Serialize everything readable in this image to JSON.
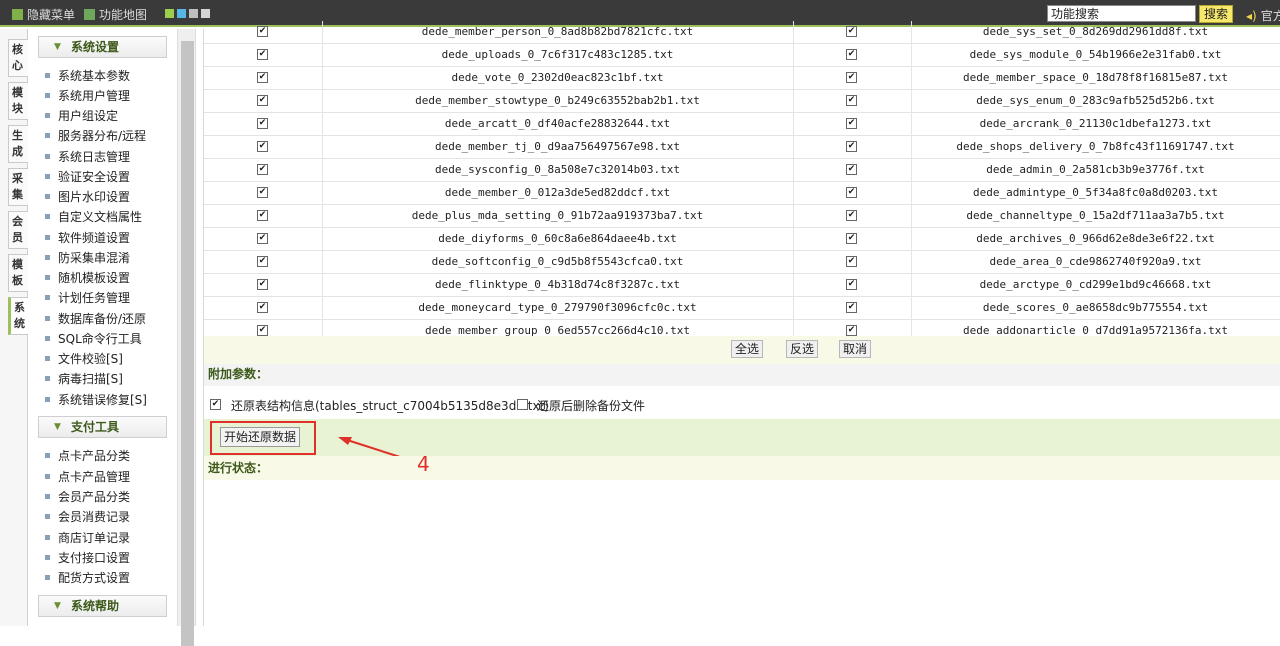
{
  "topbar": {
    "hide_menu": "隐藏菜单",
    "site_map": "功能地图",
    "search_value": "功能搜索",
    "search_button": "搜索",
    "official": "官方"
  },
  "left_tabs": [
    {
      "label": "核\n心"
    },
    {
      "label": "模\n块"
    },
    {
      "label": "生\n成"
    },
    {
      "label": "采\n集"
    },
    {
      "label": "会\n员"
    },
    {
      "label": "模\n板"
    },
    {
      "label": "系\n统"
    }
  ],
  "sidebar": {
    "sections": [
      {
        "title": "系统设置",
        "items": [
          "系统基本参数",
          "系统用户管理",
          "用户组设定",
          "服务器分布/远程",
          "系统日志管理",
          "验证安全设置",
          "图片水印设置",
          "自定义文档属性",
          "软件频道设置",
          "防采集串混淆",
          "随机模板设置",
          "计划任务管理",
          "数据库备份/还原",
          "SQL命令行工具",
          "文件校验[S]",
          "病毒扫描[S]",
          "系统错误修复[S]"
        ]
      },
      {
        "title": "支付工具",
        "items": [
          "点卡产品分类",
          "点卡产品管理",
          "会员产品分类",
          "会员消费记录",
          "商店订单记录",
          "支付接口设置",
          "配货方式设置"
        ]
      },
      {
        "title": "系统帮助",
        "items": []
      }
    ]
  },
  "table": {
    "rows": [
      {
        "left": "dede_member_person_0_8ad8b82bd7821cfc.txt",
        "right": "dede_sys_set_0_8d269dd2961dd8f.txt"
      },
      {
        "left": "dede_uploads_0_7c6f317c483c1285.txt",
        "right": "dede_sys_module_0_54b1966e2e31fab0.txt"
      },
      {
        "left": "dede_vote_0_2302d0eac823c1bf.txt",
        "right": "dede_member_space_0_18d78f8f16815e87.txt"
      },
      {
        "left": "dede_member_stowtype_0_b249c63552bab2b1.txt",
        "right": "dede_sys_enum_0_283c9afb525d52b6.txt"
      },
      {
        "left": "dede_arcatt_0_df40acfe28832644.txt",
        "right": "dede_arcrank_0_21130c1dbefa1273.txt"
      },
      {
        "left": "dede_member_tj_0_d9aa756497567e98.txt",
        "right": "dede_shops_delivery_0_7b8fc43f11691747.txt"
      },
      {
        "left": "dede_sysconfig_0_8a508e7c32014b03.txt",
        "right": "dede_admin_0_2a581cb3b9e3776f.txt"
      },
      {
        "left": "dede_member_0_012a3de5ed82ddcf.txt",
        "right": "dede_admintype_0_5f34a8fc0a8d0203.txt"
      },
      {
        "left": "dede_plus_mda_setting_0_91b72aa919373ba7.txt",
        "right": "dede_channeltype_0_15a2df711aa3a7b5.txt"
      },
      {
        "left": "dede_diyforms_0_60c8a6e864daee4b.txt",
        "right": "dede_archives_0_966d62e8de3e6f22.txt"
      },
      {
        "left": "dede_softconfig_0_c9d5b8f5543cfca0.txt",
        "right": "dede_area_0_cde9862740f920a9.txt"
      },
      {
        "left": "dede_flinktype_0_4b318d74c8f3287c.txt",
        "right": "dede_arctype_0_cd299e1bd9c46668.txt"
      },
      {
        "left": "dede_moneycard_type_0_279790f3096cfc0c.txt",
        "right": "dede_scores_0_ae8658dc9b775554.txt"
      },
      {
        "left": "dede_member_group_0_6ed557cc266d4c10.txt",
        "right": "dede_addonarticle_0_d7dd91a9572136fa.txt"
      }
    ],
    "select_all": "全选",
    "invert": "反选",
    "cancel": "取消"
  },
  "extra": {
    "title": "附加参数：",
    "restore_struct": "还原表结构信息(tables_struct_c7004b5135d8e3d1.txt)",
    "delete_after": "还原后删除备份文件"
  },
  "start_button": "开始还原数据",
  "progress_title": "进行状态：",
  "annotation": "4",
  "colors": {
    "accent_green": "#9bc25a",
    "annotation_red": "#e0302a",
    "topbar": "#3a3a3a"
  }
}
